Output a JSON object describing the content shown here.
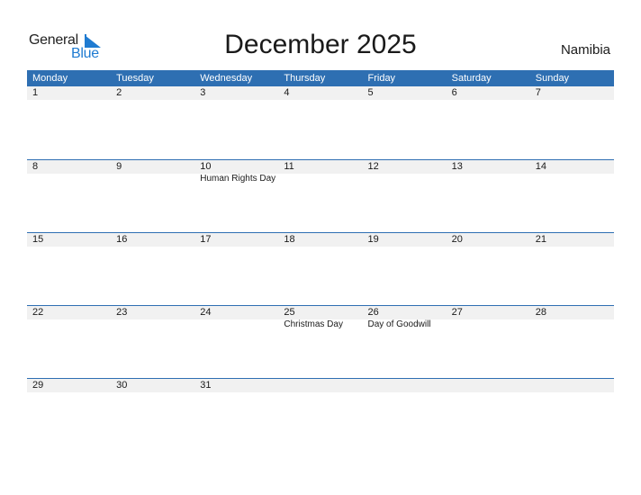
{
  "logo": {
    "text_general": "General",
    "text_blue": "Blue"
  },
  "header": {
    "title": "December 2025",
    "country": "Namibia"
  },
  "colors": {
    "accent": "#2e6fb2",
    "logo_blue": "#1f7bd1",
    "row_bg": "#f1f1f1"
  },
  "weekdays": [
    "Monday",
    "Tuesday",
    "Wednesday",
    "Thursday",
    "Friday",
    "Saturday",
    "Sunday"
  ],
  "weeks": [
    {
      "days": [
        {
          "n": "1",
          "e": ""
        },
        {
          "n": "2",
          "e": ""
        },
        {
          "n": "3",
          "e": ""
        },
        {
          "n": "4",
          "e": ""
        },
        {
          "n": "5",
          "e": ""
        },
        {
          "n": "6",
          "e": ""
        },
        {
          "n": "7",
          "e": ""
        }
      ]
    },
    {
      "days": [
        {
          "n": "8",
          "e": ""
        },
        {
          "n": "9",
          "e": ""
        },
        {
          "n": "10",
          "e": "Human Rights Day"
        },
        {
          "n": "11",
          "e": ""
        },
        {
          "n": "12",
          "e": ""
        },
        {
          "n": "13",
          "e": ""
        },
        {
          "n": "14",
          "e": ""
        }
      ]
    },
    {
      "days": [
        {
          "n": "15",
          "e": ""
        },
        {
          "n": "16",
          "e": ""
        },
        {
          "n": "17",
          "e": ""
        },
        {
          "n": "18",
          "e": ""
        },
        {
          "n": "19",
          "e": ""
        },
        {
          "n": "20",
          "e": ""
        },
        {
          "n": "21",
          "e": ""
        }
      ]
    },
    {
      "days": [
        {
          "n": "22",
          "e": ""
        },
        {
          "n": "23",
          "e": ""
        },
        {
          "n": "24",
          "e": ""
        },
        {
          "n": "25",
          "e": "Christmas Day"
        },
        {
          "n": "26",
          "e": "Day of Goodwill"
        },
        {
          "n": "27",
          "e": ""
        },
        {
          "n": "28",
          "e": ""
        }
      ]
    },
    {
      "days": [
        {
          "n": "29",
          "e": ""
        },
        {
          "n": "30",
          "e": ""
        },
        {
          "n": "31",
          "e": ""
        },
        {
          "n": "",
          "e": ""
        },
        {
          "n": "",
          "e": ""
        },
        {
          "n": "",
          "e": ""
        },
        {
          "n": "",
          "e": ""
        }
      ]
    }
  ]
}
